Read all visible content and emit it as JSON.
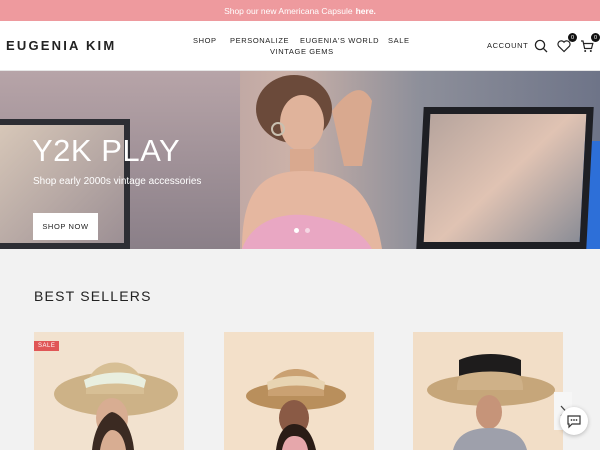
{
  "announcement": {
    "text": "Shop our new Americana Capsule",
    "link": "here."
  },
  "header": {
    "logo": "EUGENIA KIM",
    "nav": [
      "SHOP",
      "PERSONALIZE",
      "EUGENIA'S WORLD",
      "SALE",
      "VINTAGE GEMS"
    ],
    "account": "ACCOUNT",
    "wishlist_count": "0",
    "cart_count": "0",
    "icons": {
      "search": "search-icon",
      "wishlist": "heart-icon",
      "cart": "cart-icon"
    }
  },
  "hero": {
    "title": "Y2K PLAY",
    "subtitle": "Shop early 2000s vintage accessories",
    "button": "SHOP NOW",
    "slides": 2,
    "active_slide": 1
  },
  "best_sellers": {
    "title": "BEST SELLERS",
    "sale_badge": "SALE",
    "products": [
      {
        "name": "",
        "badge": "SALE"
      },
      {
        "name": ""
      },
      {
        "name": ""
      }
    ]
  },
  "colors": {
    "announcement_bg": "#ee9a9e",
    "sale_badge": "#e05656",
    "page_bg": "#f2f2f2"
  }
}
